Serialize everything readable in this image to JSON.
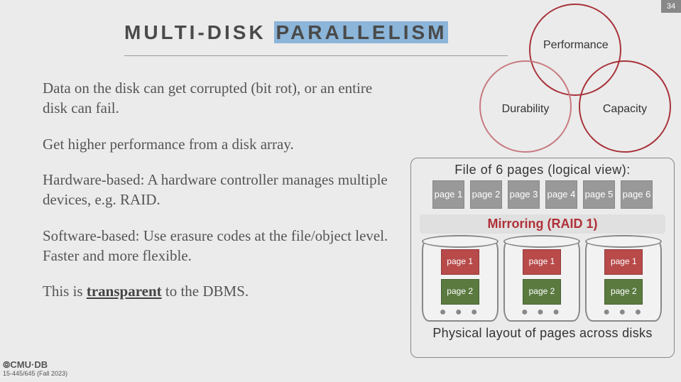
{
  "slide_number": "34",
  "title": {
    "prefix": "MULTI-DISK ",
    "highlight": "PARALLELISM"
  },
  "body": {
    "p1": "Data on the disk can get corrupted (bit rot), or an entire disk can fail.",
    "p2": "Get higher performance from a disk array.",
    "p3": "Hardware-based: A hardware controller manages multiple devices, e.g. RAID.",
    "p4": "Software-based: Use erasure codes at the file/object level. Faster and more flexible.",
    "p5_pre": "This is ",
    "p5_emph": "transparent",
    "p5_post": " to the DBMS."
  },
  "venn": {
    "top": "Performance",
    "left": "Durability",
    "right": "Capacity"
  },
  "raid": {
    "logical_title": "File of 6 pages (logical view):",
    "pages": [
      "page 1",
      "page 2",
      "page 3",
      "page 4",
      "page 5",
      "page 6"
    ],
    "mirror_label": "Mirroring (RAID 1)",
    "disks": [
      {
        "slots": [
          {
            "label": "page 1",
            "color": "red"
          },
          {
            "label": "page 2",
            "color": "green"
          }
        ]
      },
      {
        "slots": [
          {
            "label": "page 1",
            "color": "red"
          },
          {
            "label": "page 2",
            "color": "green"
          }
        ]
      },
      {
        "slots": [
          {
            "label": "page 1",
            "color": "red"
          },
          {
            "label": "page 2",
            "color": "green"
          }
        ]
      }
    ],
    "dots": "● ● ●",
    "physical_title": "Physical layout of pages across disks"
  },
  "footer": {
    "logo": "⦾CMU·DB",
    "course": "15-445/645 (Fall 2023)"
  }
}
